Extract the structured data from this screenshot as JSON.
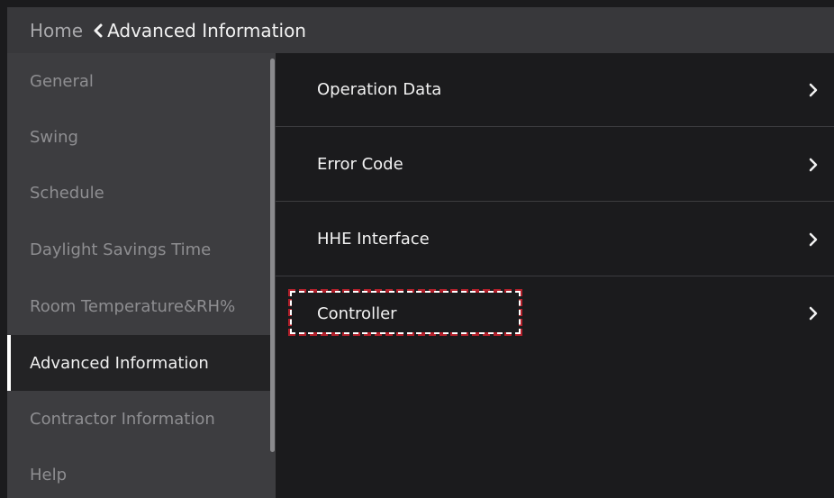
{
  "header": {
    "home_label": "Home",
    "title": "Advanced Information",
    "back_icon": "chevron-left-icon"
  },
  "sidebar": {
    "items": [
      {
        "label": "General",
        "active": false
      },
      {
        "label": "Swing",
        "active": false
      },
      {
        "label": "Schedule",
        "active": false
      },
      {
        "label": "Daylight Savings Time",
        "active": false
      },
      {
        "label": "Room Temperature&RH%",
        "active": false
      },
      {
        "label": "Advanced Information",
        "active": true
      },
      {
        "label": "Contractor Information",
        "active": false
      },
      {
        "label": "Help",
        "active": false
      }
    ]
  },
  "menu": {
    "items": [
      {
        "label": "Operation Data",
        "icon": "chevron-right-icon"
      },
      {
        "label": "Error Code",
        "icon": "chevron-right-icon"
      },
      {
        "label": "HHE Interface",
        "icon": "chevron-right-icon"
      },
      {
        "label": "Controller",
        "icon": "chevron-right-icon",
        "highlighted": true
      }
    ]
  },
  "colors": {
    "background": "#1b1b1d",
    "header": "#38383b",
    "sidebar": "#3d3d40",
    "sidebar_active": "#232325",
    "highlight": "#b3202b"
  }
}
